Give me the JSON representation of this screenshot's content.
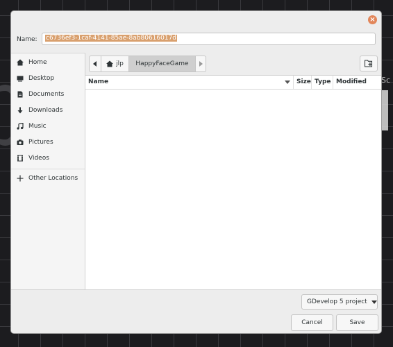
{
  "background": {
    "partial_text": "Sc"
  },
  "dialog": {
    "name_label": "Name:",
    "name_value": "c6736ef3-1caf-4141-85ae-8ab80616017d",
    "close_icon": "close-icon"
  },
  "sidebar": {
    "items": [
      {
        "label": "Home",
        "icon": "home-icon"
      },
      {
        "label": "Desktop",
        "icon": "desktop-icon"
      },
      {
        "label": "Documents",
        "icon": "documents-icon"
      },
      {
        "label": "Downloads",
        "icon": "download-icon"
      },
      {
        "label": "Music",
        "icon": "music-icon"
      },
      {
        "label": "Pictures",
        "icon": "camera-icon"
      },
      {
        "label": "Videos",
        "icon": "film-icon"
      }
    ],
    "other_locations": "Other Locations"
  },
  "pathbar": {
    "segments": [
      "jlp",
      "HappyFaceGame"
    ]
  },
  "file_list": {
    "columns": [
      "Name",
      "Size",
      "Type",
      "Modified"
    ],
    "rows": []
  },
  "footer": {
    "filter": "GDevelop 5 project",
    "cancel": "Cancel",
    "save": "Save"
  },
  "colors": {
    "selection": "#d9a06e",
    "close_button": "#e2865a"
  }
}
